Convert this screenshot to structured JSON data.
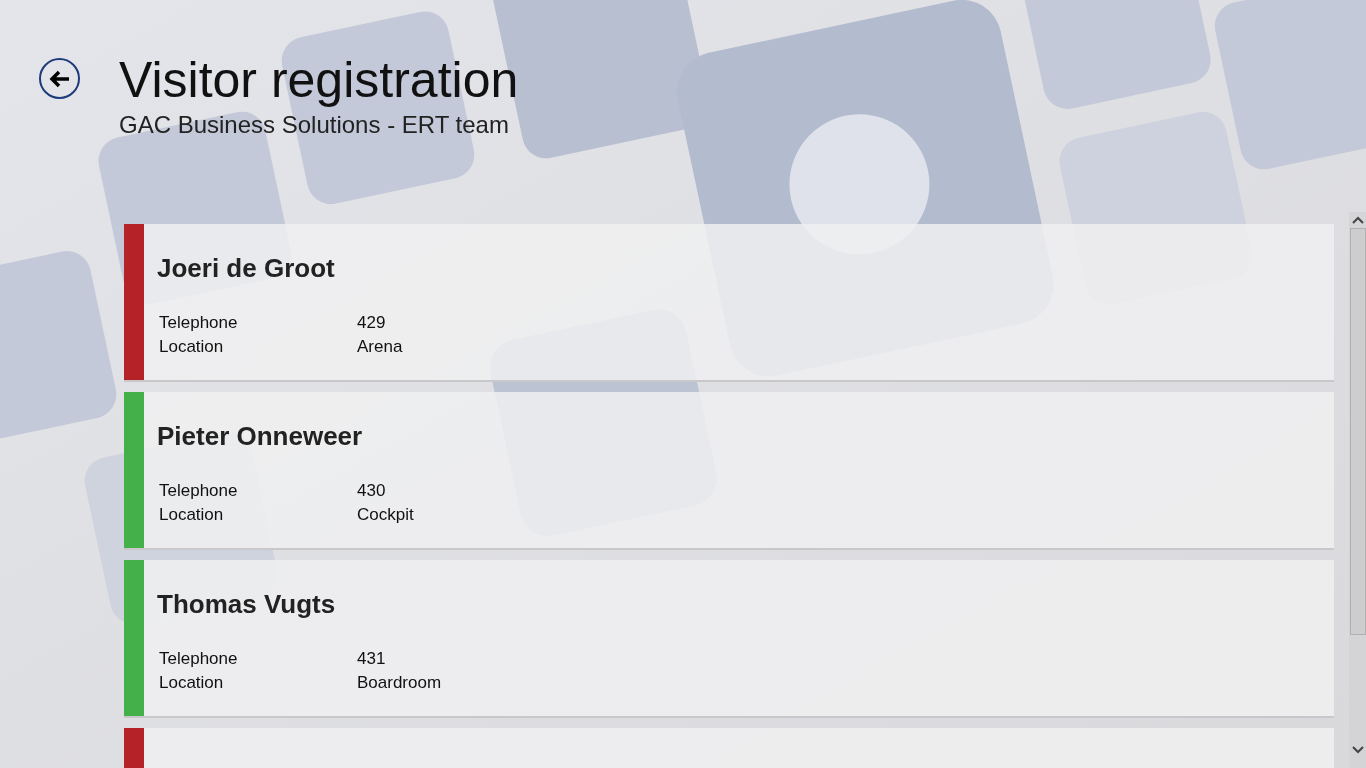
{
  "header": {
    "title": "Visitor registration",
    "subtitle": "GAC Business Solutions - ERT team"
  },
  "visitors": [
    {
      "name": "Joeri de Groot",
      "color": "#b52228",
      "fields": [
        {
          "label": "Telephone",
          "value": "429"
        },
        {
          "label": "Location",
          "value": "Arena"
        }
      ]
    },
    {
      "name": "Pieter Onneweer",
      "color": "#43b04a",
      "fields": [
        {
          "label": "Telephone",
          "value": "430"
        },
        {
          "label": "Location",
          "value": "Cockpit"
        }
      ]
    },
    {
      "name": "Thomas Vugts",
      "color": "#43b04a",
      "fields": [
        {
          "label": "Telephone",
          "value": "431"
        },
        {
          "label": "Location",
          "value": "Boardroom"
        }
      ]
    },
    {
      "color": "#b52228"
    }
  ]
}
